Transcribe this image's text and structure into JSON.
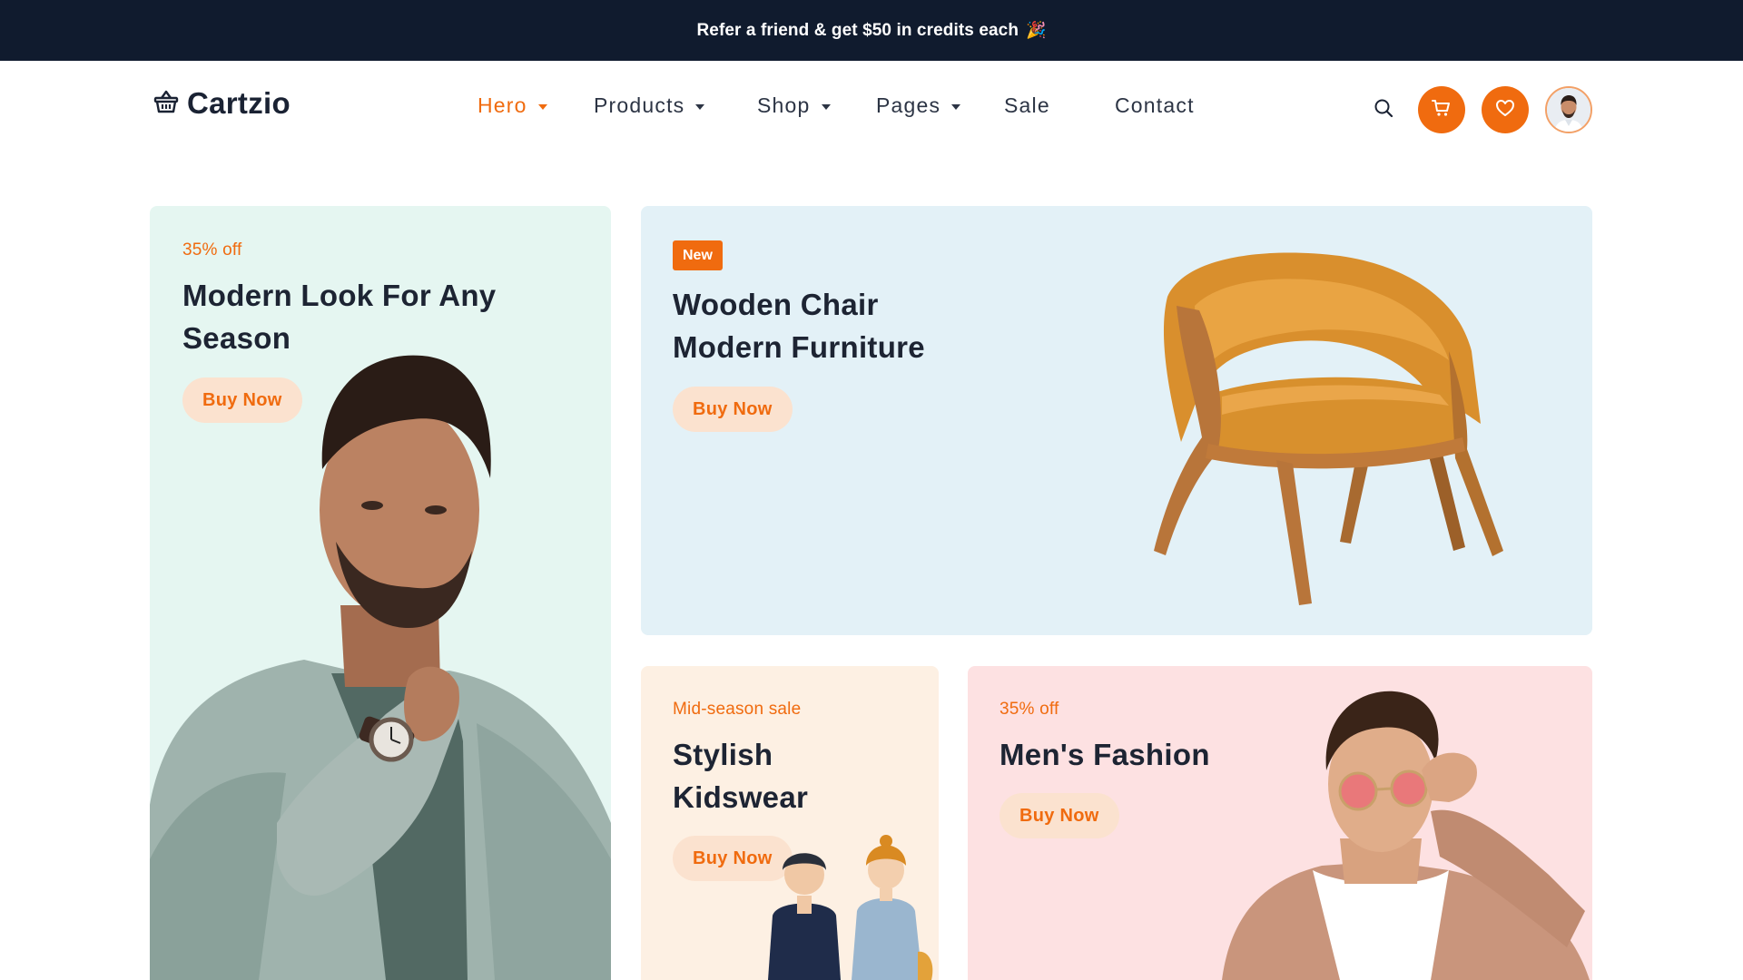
{
  "announcement": {
    "text": "Refer a friend & get $50 in credits each",
    "emoji": "🎉"
  },
  "brand": {
    "name": "Cartzio",
    "icon": "basket-icon"
  },
  "nav": [
    {
      "label": "Hero",
      "dropdown": true,
      "active": true
    },
    {
      "label": "Products",
      "dropdown": true
    },
    {
      "label": "Shop",
      "dropdown": true
    },
    {
      "label": "Pages",
      "dropdown": true
    },
    {
      "label": "Sale",
      "dropdown": false
    },
    {
      "label": "Contact",
      "dropdown": false
    }
  ],
  "actions": {
    "search_icon": "search-icon",
    "cart_icon": "cart-icon",
    "wishlist_icon": "heart-icon",
    "avatar": "user-avatar"
  },
  "cards": {
    "season": {
      "kicker": "35% off",
      "title_line1": "Modern Look For Any",
      "title_line2": "Season",
      "button": "Buy Now"
    },
    "chair": {
      "badge": "New",
      "title_line1": "Wooden Chair",
      "title_line2": "Modern Furniture",
      "button": "Buy Now"
    },
    "kids": {
      "kicker": "Mid-season sale",
      "title_line1": "Stylish",
      "title_line2": "Kidswear",
      "button": "Buy Now"
    },
    "mens": {
      "kicker": "35% off",
      "title_line1": "Men's Fashion",
      "button": "Buy Now"
    }
  },
  "colors": {
    "accent": "#f06b0f",
    "topbar": "#101b2e",
    "card_mint": "#e5f6f1",
    "card_blue": "#e3f1f7",
    "card_cream": "#fdf0e3",
    "card_pink": "#fde1e2"
  }
}
